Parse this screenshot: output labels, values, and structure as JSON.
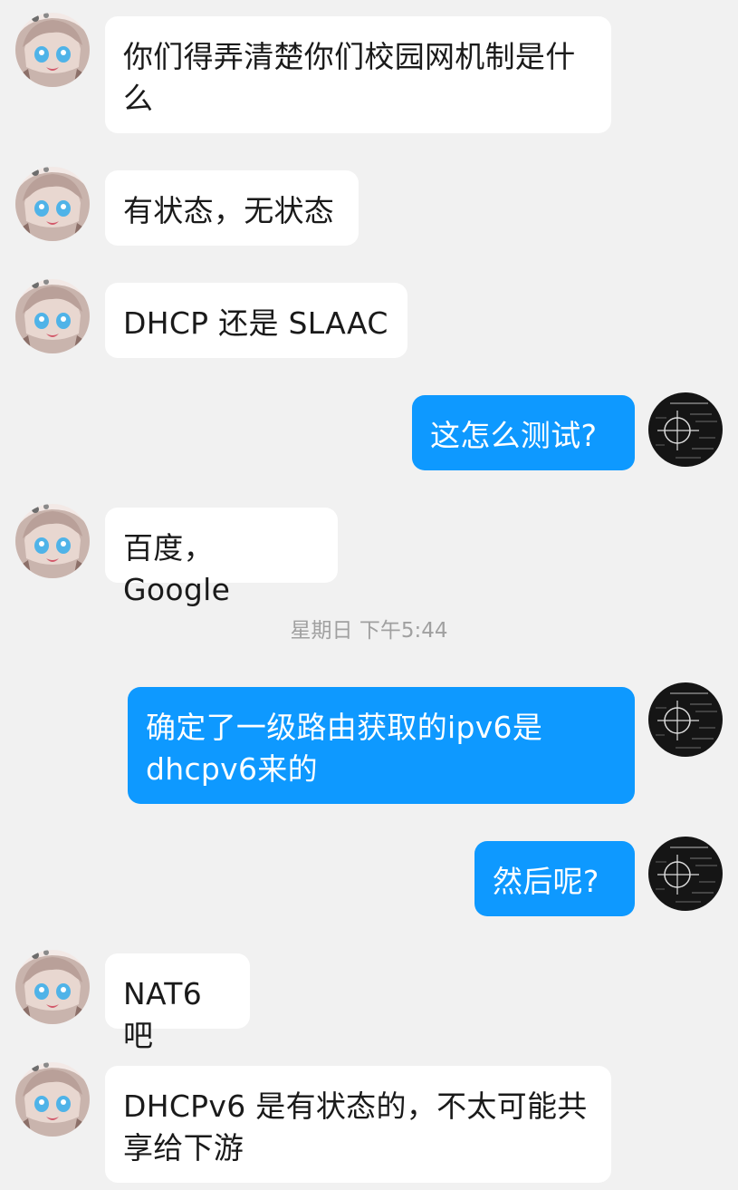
{
  "conversation": {
    "messages": [
      {
        "side": "in",
        "text": "你们得弄清楚你们校园网机制是什么"
      },
      {
        "side": "in",
        "text": "有状态，无状态"
      },
      {
        "side": "in",
        "text": "DHCP 还是 SLAAC"
      },
      {
        "side": "out",
        "text": "这怎么测试?"
      },
      {
        "side": "in",
        "text": "百度，Google"
      },
      {
        "side": "out",
        "text": "确定了一级路由获取的ipv6是dhcpv6来的"
      },
      {
        "side": "out",
        "text": "然后呢?"
      },
      {
        "side": "in",
        "text": "NAT6吧"
      },
      {
        "side": "in",
        "text": "DHCPv6 是有状态的，不太可能共享给下游"
      }
    ],
    "timestamp": "星期日 下午5:44"
  },
  "colors": {
    "background": "#f1f1f1",
    "incoming_bubble": "#ffffff",
    "outgoing_bubble": "#0e99ff",
    "timestamp_text": "#a0a0a0"
  },
  "icons": {
    "contact_avatar": "anime-girl-avatar-icon",
    "self_avatar": "math-chalkboard-avatar-icon"
  }
}
